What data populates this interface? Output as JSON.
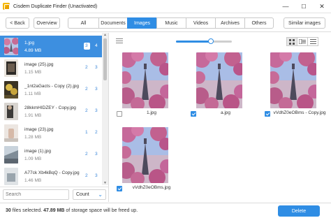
{
  "window": {
    "title": "Cisdem Duplicate Finder (Unactivated)",
    "minimize": "—",
    "maximize": "☐",
    "close": "✕"
  },
  "toolbar": {
    "back_label": "< Back",
    "overview_label": "Overview",
    "tabs": [
      "All",
      "Documents",
      "Images",
      "Music",
      "Videos",
      "Archives",
      "Others"
    ],
    "active_tab": "Images",
    "similar_label": "Similar images"
  },
  "files": [
    {
      "name": "1.jpg",
      "size": "4.89 MB",
      "count_a": "3",
      "count_b": "4",
      "selected": true
    },
    {
      "name": "image (25).jpg",
      "size": "1.15 MB",
      "count_a": "2",
      "count_b": "3",
      "selected": false
    },
    {
      "name": "_1nt2aGacts - Copy (2).jpg",
      "size": "1.11 MB",
      "count_a": "2",
      "count_b": "3",
      "selected": false
    },
    {
      "name": "28kkmHIDZEY - Copy.jpg",
      "size": "1.91 MB",
      "count_a": "2",
      "count_b": "3",
      "selected": false
    },
    {
      "name": "image (23).jpg",
      "size": "1.28 MB",
      "count_a": "1",
      "count_b": "2",
      "selected": false
    },
    {
      "name": "image (1).jpg",
      "size": "1.09 MB",
      "count_a": "2",
      "count_b": "3",
      "selected": false
    },
    {
      "name": "A77ck Xb4kBqQ - Copy.jpg",
      "size": "1.46 MB",
      "count_a": "2",
      "count_b": "3",
      "selected": false
    }
  ],
  "search": {
    "placeholder": "Search"
  },
  "sort": {
    "label": "Count"
  },
  "slider": {
    "level": 0.62
  },
  "images": [
    {
      "caption": "1.jpg",
      "checked": false
    },
    {
      "caption": "a.jpg",
      "checked": true
    },
    {
      "caption": "vVdhZ0eOBms - Copy.jpg",
      "checked": true
    },
    {
      "caption": "vVdhZ0eOBms.jpg",
      "checked": true
    }
  ],
  "status": {
    "count": "30",
    "text1": " files selected. ",
    "size": "47.89 MB",
    "text2": " of storage space will be freed up."
  },
  "delete_label": "Delete",
  "colors": {
    "accent": "#2f8de4"
  }
}
